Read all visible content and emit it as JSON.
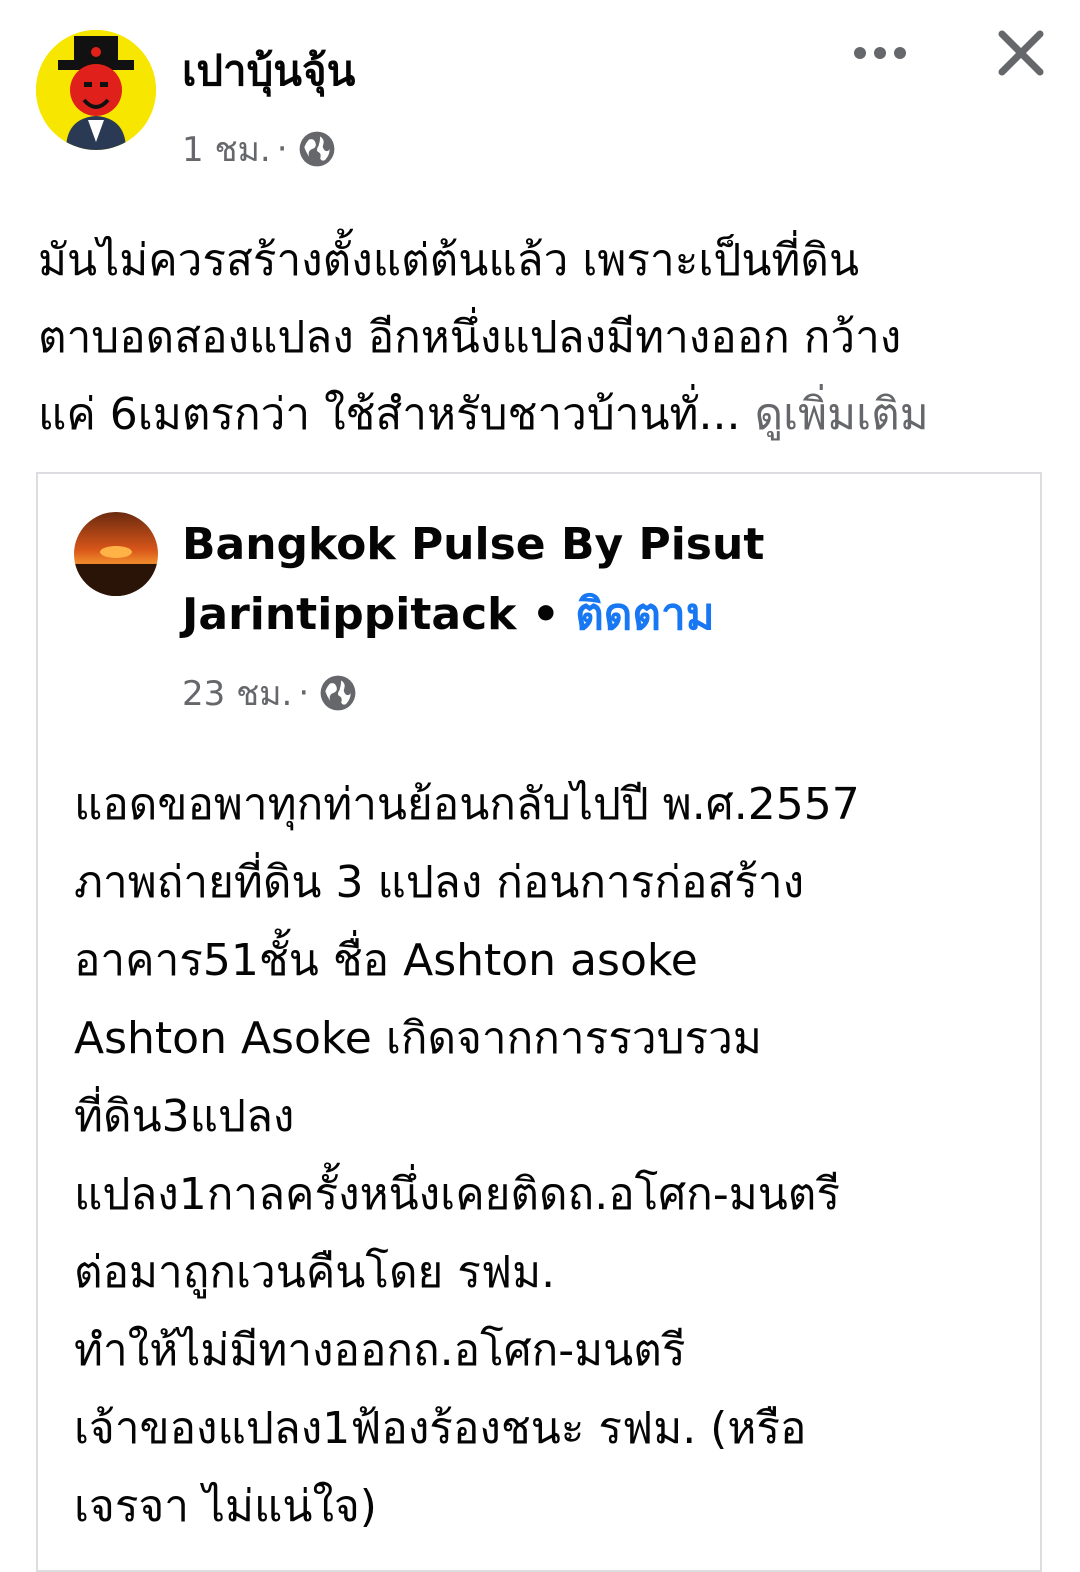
{
  "post": {
    "author": "เปาบุ้นจุ้น",
    "time": "1 ชม.",
    "separator": "·",
    "privacy_icon": "globe-icon",
    "more_icon": "more-horizontal-icon",
    "close_icon": "close-icon",
    "text_lines": [
      "มันไม่ควรสร้างตั้งแต่ต้นแล้ว เพราะเป็นที่ดิน",
      "ตาบอดสองแปลง อีกหนึ่งแปลงมีทางออก กว้าง",
      "แค่ 6เมตรกว่า ใช้สำหรับชาวบ้านทั่..."
    ],
    "see_more": "ดูเพิ่มเติม"
  },
  "shared": {
    "name_line1": "Bangkok Pulse By Pisut",
    "name_line2": "Jarintippitack",
    "bullet": "•",
    "follow": "ติดตาม",
    "time": "23 ชม.",
    "separator": "·",
    "privacy_icon": "globe-icon",
    "text_lines": [
      "แอดขอพาทุกท่านย้อนกลับไปปี พ.ศ.2557",
      "ภาพถ่ายที่ดิน 3 แปลง ก่อนการก่อสร้าง",
      "อาคาร51ชั้น ชื่อ Ashton asoke",
      "Ashton Asoke เกิดจากการรวบรวม",
      "ที่ดิน3แปลง",
      "แปลง1กาลครั้งหนึ่งเคยติดถ.อโศก-มนตรี",
      "ต่อมาถูกเวนคืนโดย รฟม.",
      "ทำให้ไม่มีทางออกถ.อโศก-มนตรี",
      "เจ้าของแปลง1ฟ้องร้องชนะ รฟม. (หรือ",
      "เจรจา ไม่แน่ใจ)"
    ]
  },
  "colors": {
    "text": "#050505",
    "secondary": "#65676b",
    "link": "#1877f2",
    "border": "#dcdde1",
    "avatar_bg": "#f7e600"
  }
}
